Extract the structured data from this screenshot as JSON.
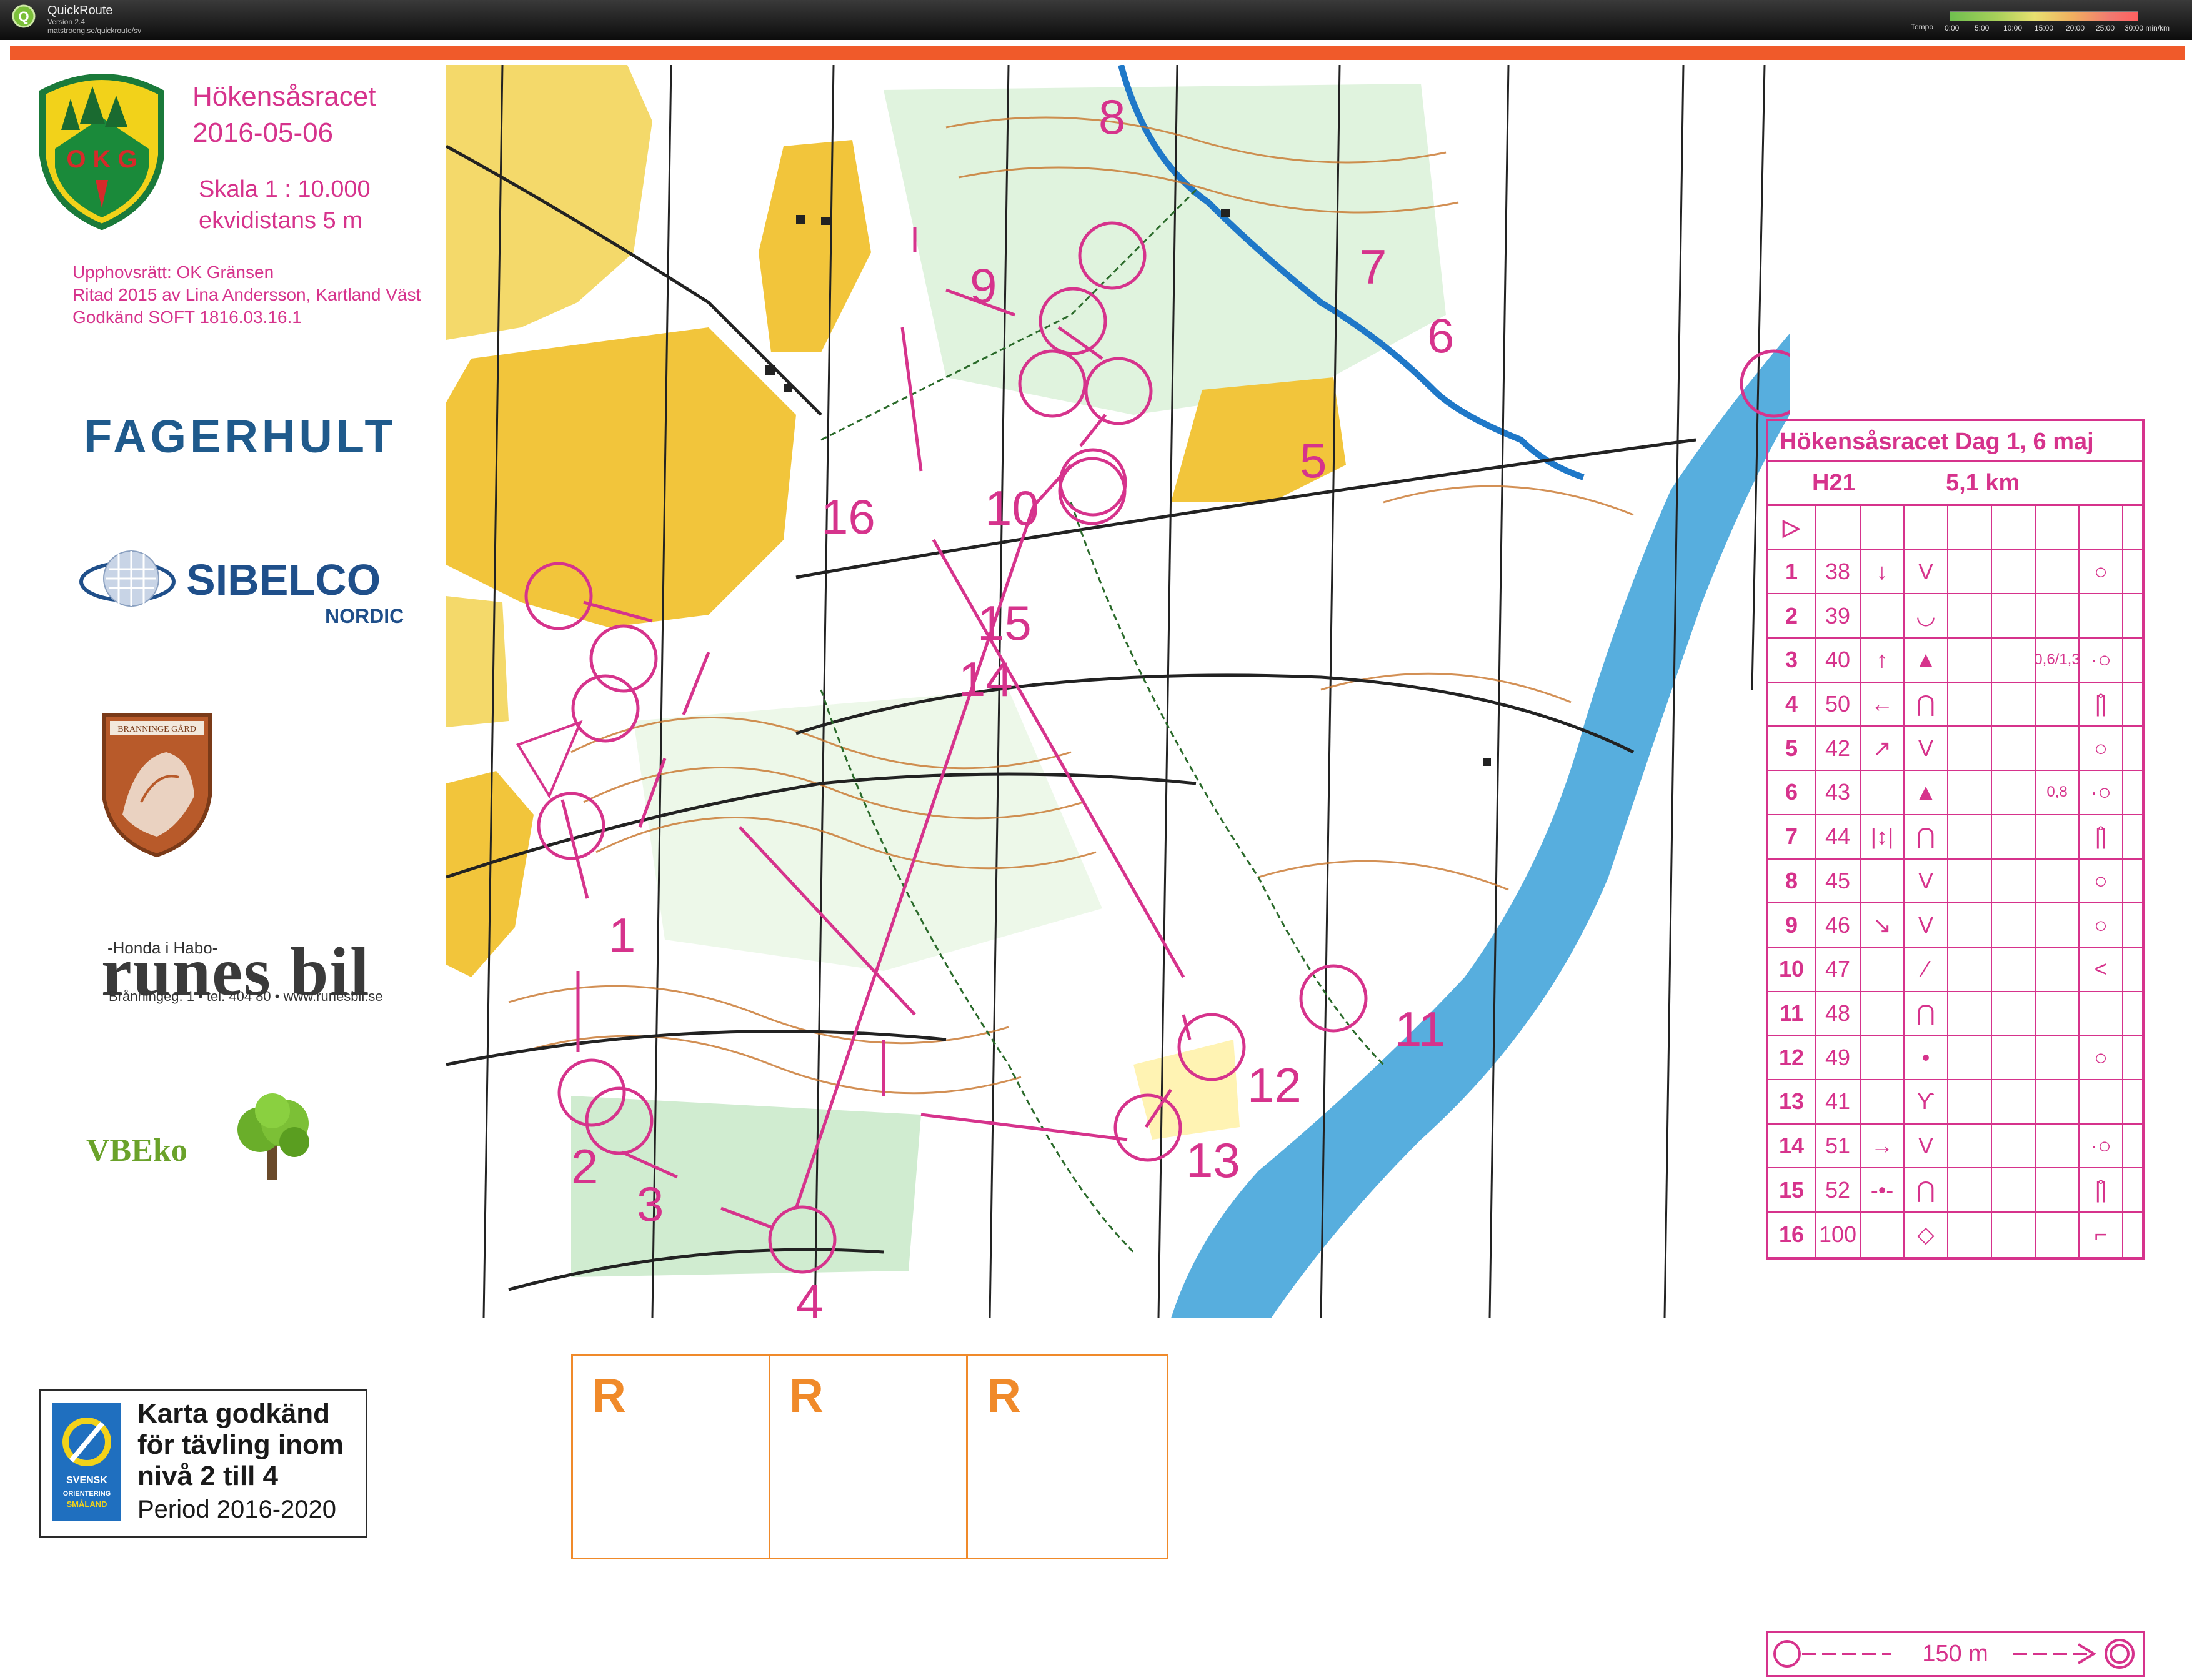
{
  "app": {
    "name": "QuickRoute",
    "version": "Version 2.4",
    "url": "matstroeng.se/quickroute/sv",
    "tempo_label": "Tempo",
    "tempo_ticks": [
      "0:00",
      "5:00",
      "10:00",
      "15:00",
      "20:00",
      "25:00",
      "30:00 min/km"
    ]
  },
  "club_logo": {
    "text": "O K G"
  },
  "event": {
    "title_line1": "Hökensåsracet",
    "title_line2": "2016-05-06",
    "scale_line": "Skala 1 : 10.000",
    "contour_line": "ekvidistans 5 m"
  },
  "credits": {
    "line1": "Upphovsrätt: OK Gränsen",
    "line2": "Ritad 2015 av Lina Andersson, Kartland Väst",
    "line3": "Godkänd SOFT 1816.03.16.1"
  },
  "sponsors": {
    "fagerhult": "FAGERHULT",
    "sibelco": "SIBELCO",
    "sibelco_sub": "NORDIC",
    "branninge": "BRANNINGE GÅRD",
    "honda": "-Honda i Habo-",
    "runes": "runes bil",
    "runes_address": "Brånningeg. 1 • tel. 404 80 • www.runesbil.se",
    "vbeko": "VBEko"
  },
  "approval": {
    "line1": "Karta godkänd",
    "line2": "för tävling inom",
    "line3": "nivå 2 till 4",
    "period": "Period 2016-2020",
    "logo_text": "SVENSK ORIENTERING SMÅLAND"
  },
  "r_boxes": [
    "R",
    "R",
    "R"
  ],
  "map": {
    "control_numbers": [
      "1",
      "2",
      "3",
      "4",
      "5",
      "6",
      "7",
      "8",
      "9",
      "10",
      "11",
      "12",
      "13",
      "14",
      "15",
      "16"
    ],
    "colors": {
      "course": "#d6338c",
      "forest_open": "#f2c53b",
      "water": "#3aa0d8",
      "green": "#8fd08f",
      "contours": "#c8742a",
      "paths": "#222222"
    }
  },
  "description": {
    "title": "Hökensåsracet Dag 1, 6 maj",
    "class": "H21",
    "length": "5,1 km",
    "rows": [
      {
        "n": "1",
        "code": "38",
        "dir": "↓",
        "feat": "V",
        "dim": "",
        "loc": "○"
      },
      {
        "n": "2",
        "code": "39",
        "dir": "",
        "feat": "◡",
        "dim": "",
        "loc": ""
      },
      {
        "n": "3",
        "code": "40",
        "dir": "↑",
        "feat": "▲",
        "dim": "0,6/1,3",
        "loc": "·○"
      },
      {
        "n": "4",
        "code": "50",
        "dir": "←",
        "feat": "⋂",
        "dim": "",
        "loc": "|̊|"
      },
      {
        "n": "5",
        "code": "42",
        "dir": "↗",
        "feat": "V",
        "dim": "",
        "loc": "○"
      },
      {
        "n": "6",
        "code": "43",
        "dir": "",
        "feat": "▲",
        "dim": "0,8",
        "loc": "·○"
      },
      {
        "n": "7",
        "code": "44",
        "dir": "|↕|",
        "feat": "⋂",
        "dim": "",
        "loc": "|̊|"
      },
      {
        "n": "8",
        "code": "45",
        "dir": "",
        "feat": "V",
        "dim": "",
        "loc": "○"
      },
      {
        "n": "9",
        "code": "46",
        "dir": "↘",
        "feat": "V",
        "dim": "",
        "loc": "○"
      },
      {
        "n": "10",
        "code": "47",
        "dir": "",
        "feat": "⁄",
        "dim": "",
        "loc": "<"
      },
      {
        "n": "11",
        "code": "48",
        "dir": "",
        "feat": "⋂",
        "dim": "",
        "loc": ""
      },
      {
        "n": "12",
        "code": "49",
        "dir": "",
        "feat": "•",
        "dim": "",
        "loc": "○"
      },
      {
        "n": "13",
        "code": "41",
        "dir": "",
        "feat": "Ƴ",
        "dim": "",
        "loc": ""
      },
      {
        "n": "14",
        "code": "51",
        "dir": "→",
        "feat": "V",
        "dim": "",
        "loc": "·○"
      },
      {
        "n": "15",
        "code": "52",
        "dir": "-•-",
        "feat": "⋂",
        "dim": "",
        "loc": "|̊|"
      },
      {
        "n": "16",
        "code": "100",
        "dir": "",
        "feat": "◇",
        "dim": "",
        "loc": "⌐"
      }
    ],
    "footer": "150 m"
  }
}
